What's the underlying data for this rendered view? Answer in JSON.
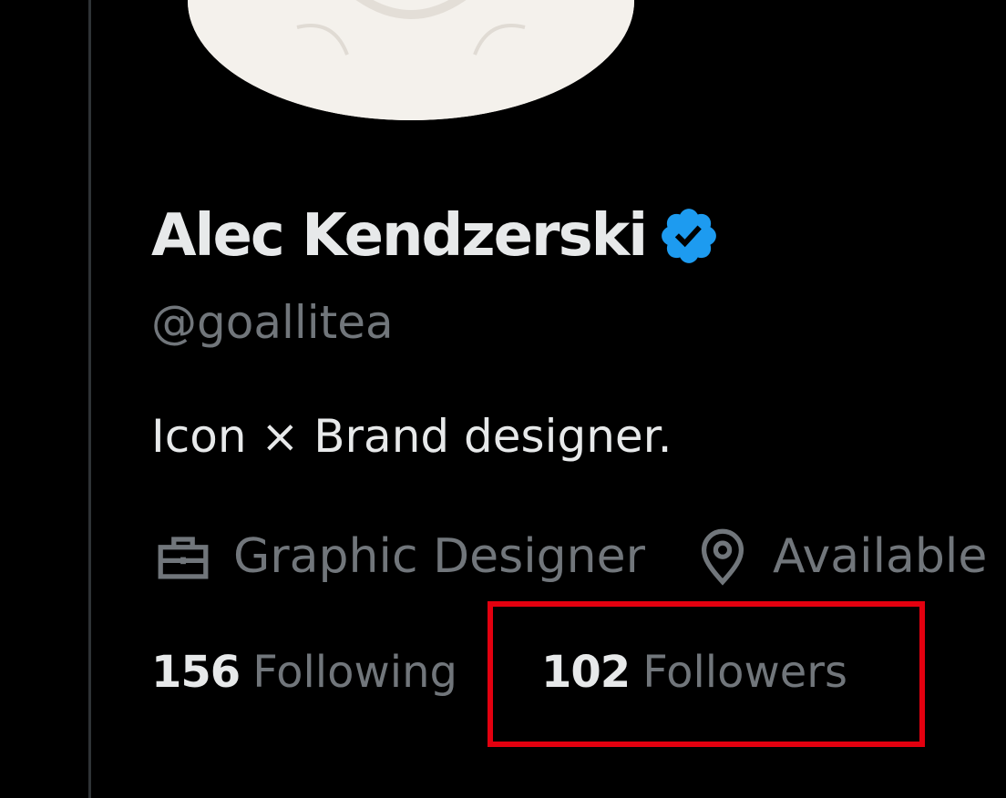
{
  "profile": {
    "display_name": "Alec Kendzerski",
    "handle": "@goallitea",
    "bio": "Icon × Brand designer.",
    "verified": true,
    "avatar_icon": "avatar-photo"
  },
  "meta": {
    "profession": {
      "icon": "briefcase-icon",
      "label": "Graphic Designer"
    },
    "location": {
      "icon": "location-pin-icon",
      "label": "Available"
    }
  },
  "stats": {
    "following": {
      "count": "156",
      "label": "Following"
    },
    "followers": {
      "count": "102",
      "label": "Followers"
    }
  },
  "colors": {
    "background": "#000000",
    "primary_text": "#e7e9ea",
    "secondary_text": "#71767b",
    "verified_blue": "#1d9bf0",
    "highlight": "#e3000f"
  }
}
